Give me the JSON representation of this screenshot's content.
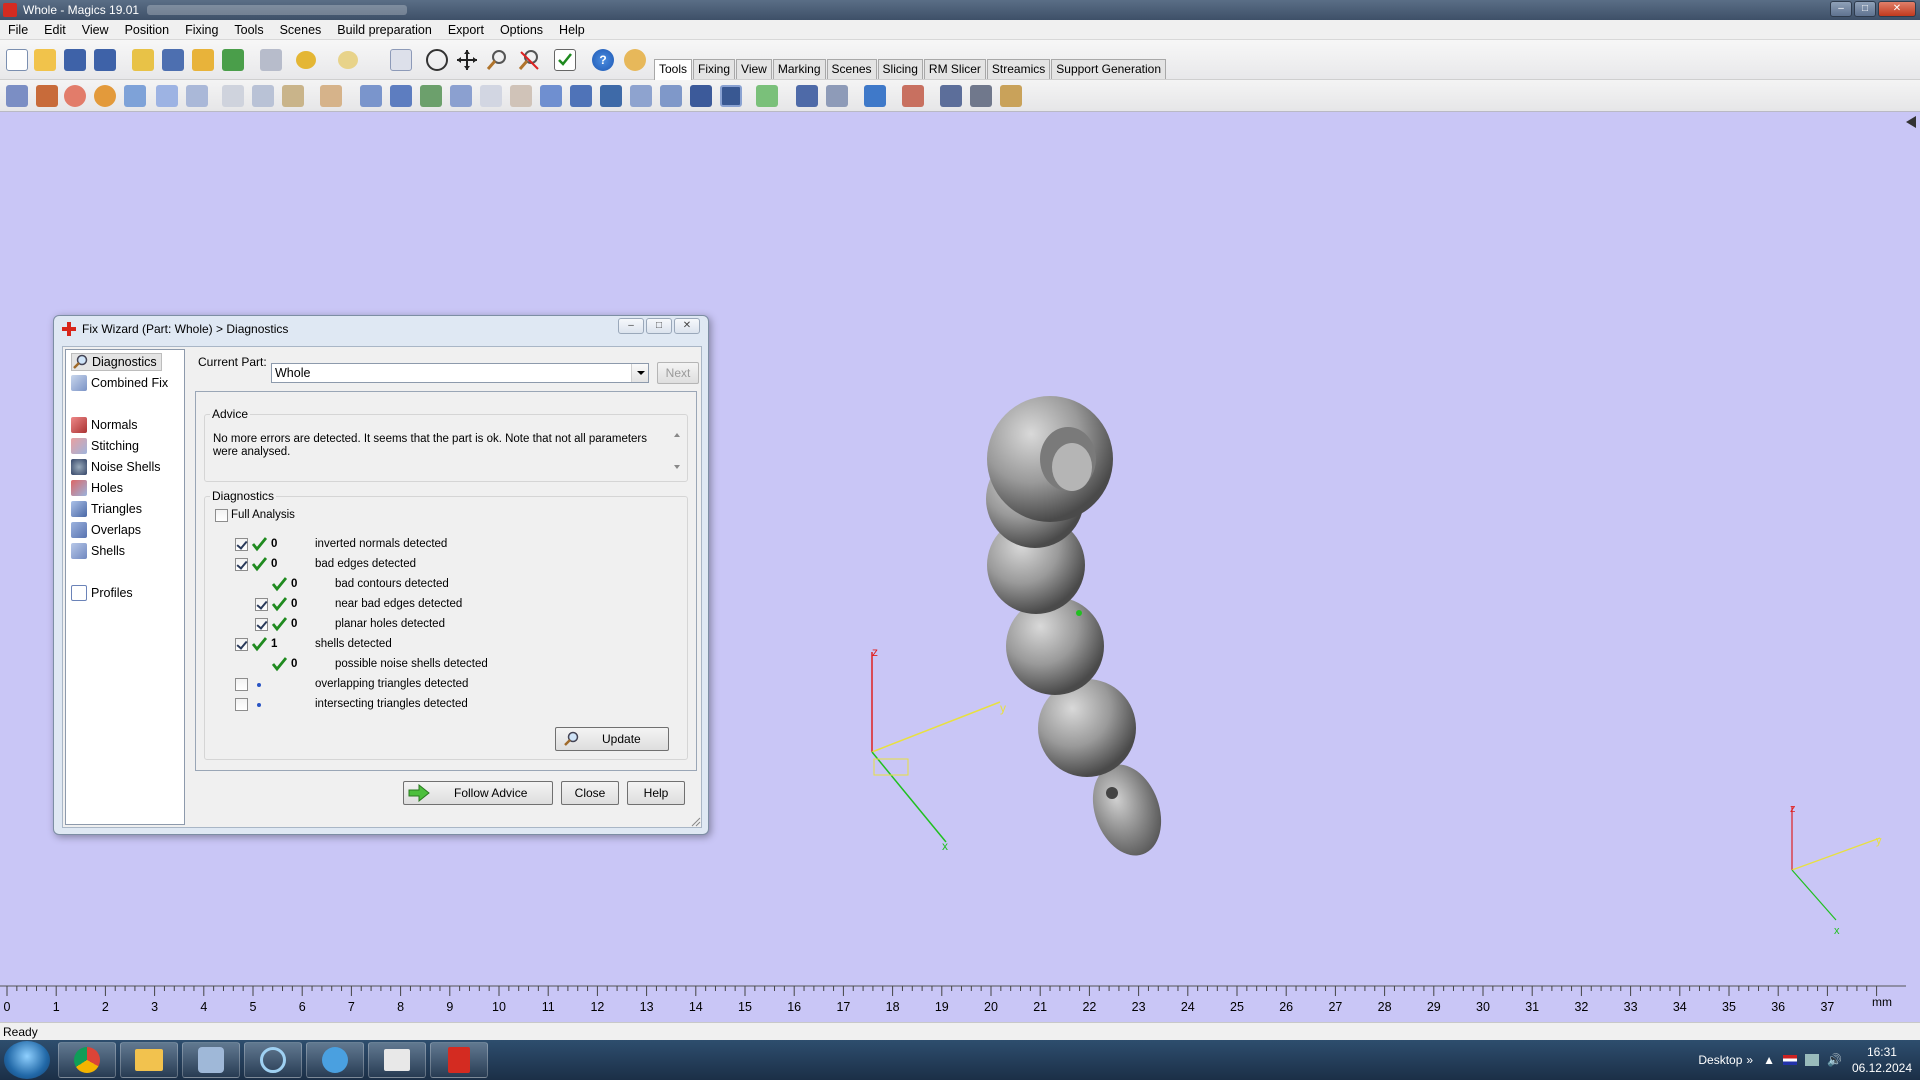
{
  "window": {
    "title": "Whole - Magics 19.01"
  },
  "menu": [
    "File",
    "Edit",
    "View",
    "Position",
    "Fixing",
    "Tools",
    "Scenes",
    "Build preparation",
    "Export",
    "Options",
    "Help"
  ],
  "tabs": [
    "Tools",
    "Fixing",
    "View",
    "Marking",
    "Scenes",
    "Slicing",
    "RM Slicer",
    "Streamics",
    "Support Generation"
  ],
  "active_tab": "Tools",
  "dialog": {
    "title": "Fix Wizard (Part: Whole) > Diagnostics",
    "nav": {
      "diagnostics": "Diagnostics",
      "combined_fix": "Combined Fix",
      "normals": "Normals",
      "stitching": "Stitching",
      "noise_shells": "Noise Shells",
      "holes": "Holes",
      "triangles": "Triangles",
      "overlaps": "Overlaps",
      "shells": "Shells",
      "profiles": "Profiles"
    },
    "current_part_label": "Current Part:",
    "current_part_value": "Whole",
    "next_label": "Next",
    "advice_title": "Advice",
    "advice_text": "No more errors are detected. It seems that the part is ok. Note that not all parameters were analysed.",
    "diagnostics_title": "Diagnostics",
    "full_analysis_label": "Full Analysis",
    "rows": [
      {
        "count": "0",
        "label": "inverted normals detected"
      },
      {
        "count": "0",
        "label": "bad edges detected"
      },
      {
        "count": "0",
        "label": "bad contours detected"
      },
      {
        "count": "0",
        "label": "near bad edges detected"
      },
      {
        "count": "0",
        "label": "planar holes detected"
      },
      {
        "count": "1",
        "label": "shells detected"
      },
      {
        "count": "0",
        "label": "possible noise shells detected"
      },
      {
        "count": "",
        "label": "overlapping triangles detected"
      },
      {
        "count": "",
        "label": "intersecting triangles detected"
      }
    ],
    "update_label": "Update",
    "follow_advice_label": "Follow Advice",
    "close_label": "Close",
    "help_label": "Help"
  },
  "axes": {
    "x": "x",
    "y": "y",
    "z": "z"
  },
  "ruler": {
    "ticks": [
      "0",
      "1",
      "2",
      "3",
      "4",
      "5",
      "6",
      "7",
      "8",
      "9",
      "10",
      "11",
      "12",
      "13",
      "14",
      "15",
      "16",
      "17",
      "18",
      "19",
      "20",
      "21",
      "22",
      "23",
      "24",
      "25",
      "26",
      "27",
      "28",
      "29",
      "30",
      "31",
      "32",
      "33",
      "34",
      "35",
      "36",
      "37"
    ],
    "unit": "mm"
  },
  "status": {
    "text": "Ready"
  },
  "taskbar": {
    "desktop_label": "Desktop",
    "time": "16:31",
    "date": "06.12.2024"
  },
  "colors": {
    "viewport_bg": "#c9c6f6",
    "accent_red": "#d42b21",
    "check_green": "#1f8a1f"
  }
}
